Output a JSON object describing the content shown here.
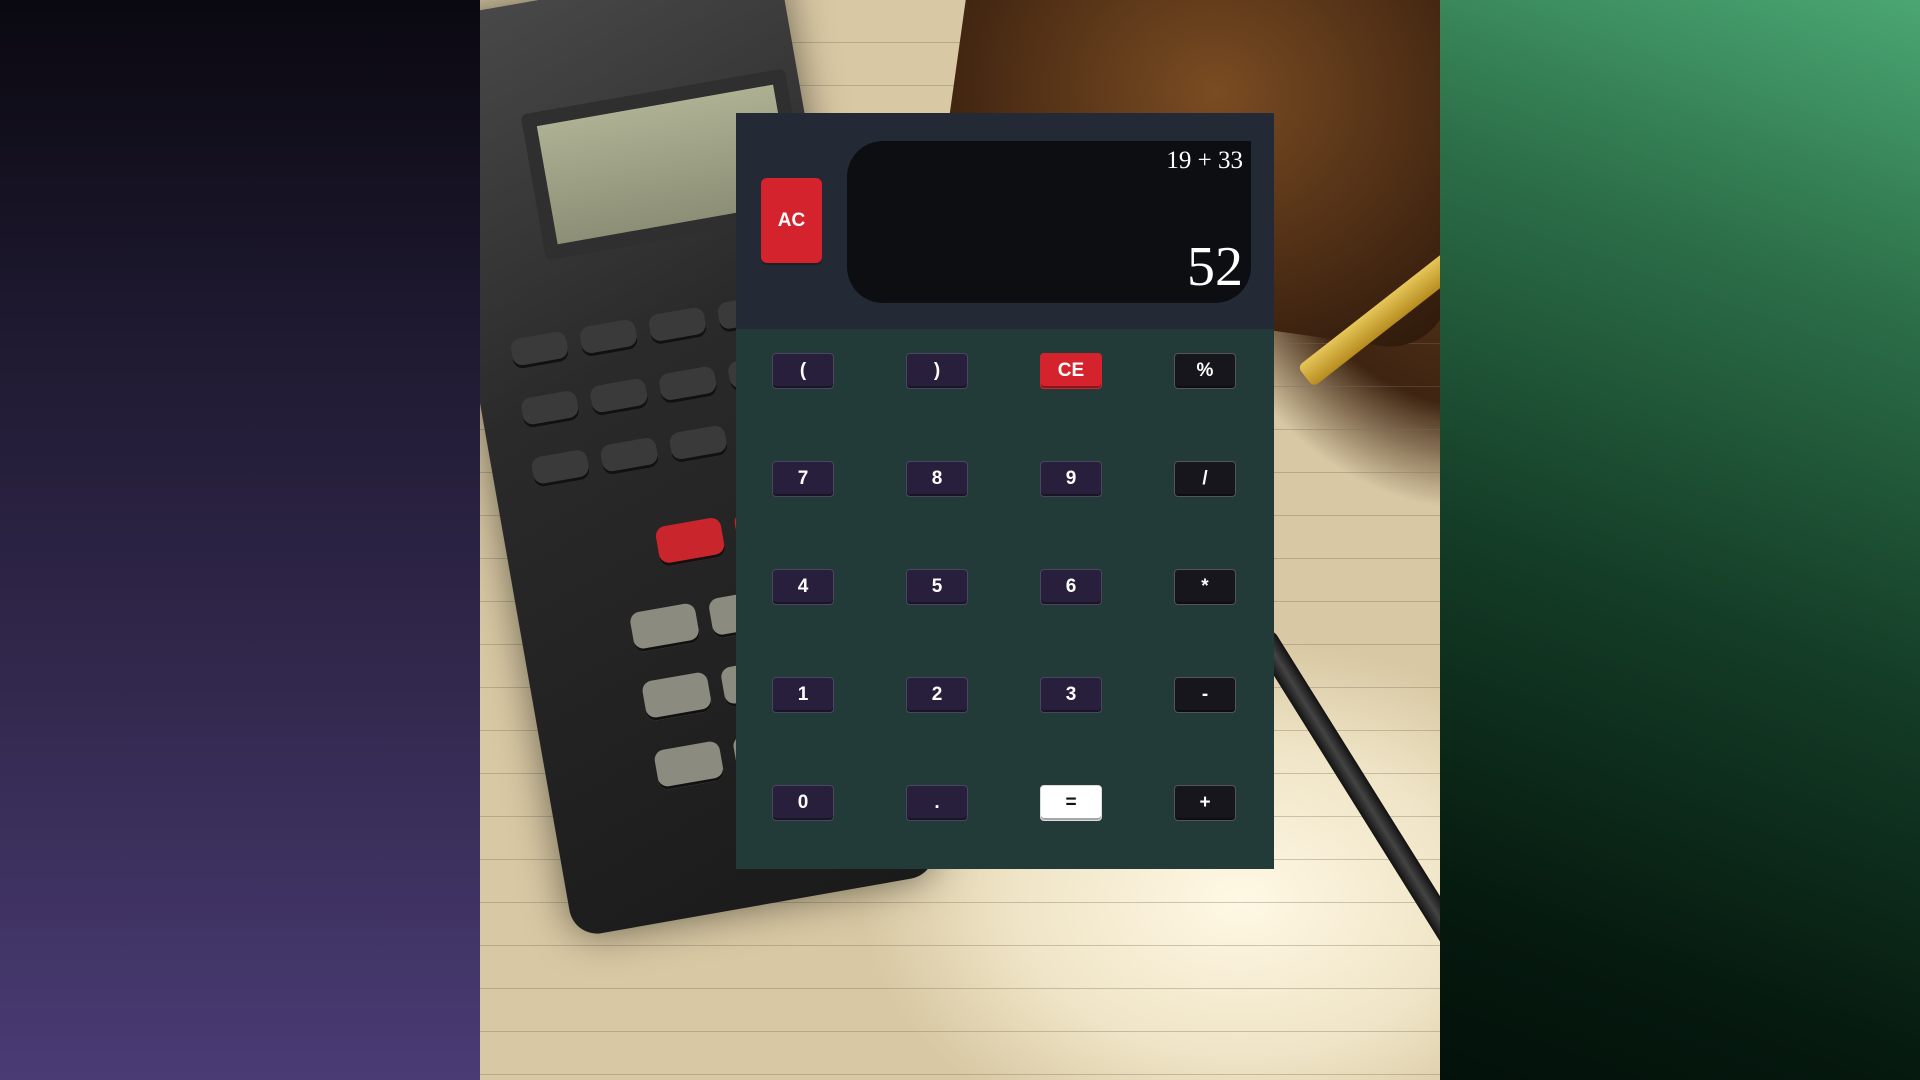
{
  "calculator": {
    "clear_all_label": "AC",
    "display": {
      "expression": "19 + 33",
      "result": "52"
    },
    "keys": [
      {
        "label": "(",
        "style": "purple"
      },
      {
        "label": ")",
        "style": "purple"
      },
      {
        "label": "CE",
        "style": "red"
      },
      {
        "label": "%",
        "style": "dark"
      },
      {
        "label": "7",
        "style": "purple"
      },
      {
        "label": "8",
        "style": "purple"
      },
      {
        "label": "9",
        "style": "purple"
      },
      {
        "label": "/",
        "style": "dark"
      },
      {
        "label": "4",
        "style": "purple"
      },
      {
        "label": "5",
        "style": "purple"
      },
      {
        "label": "6",
        "style": "purple"
      },
      {
        "label": "*",
        "style": "dark"
      },
      {
        "label": "1",
        "style": "purple"
      },
      {
        "label": "2",
        "style": "purple"
      },
      {
        "label": "3",
        "style": "purple"
      },
      {
        "label": "-",
        "style": "dark"
      },
      {
        "label": "0",
        "style": "purple"
      },
      {
        "label": ".",
        "style": "purple"
      },
      {
        "label": "=",
        "style": "white"
      },
      {
        "label": "+",
        "style": "dark"
      }
    ]
  },
  "colors": {
    "accent_red": "#d5232d",
    "key_purple": "#271f3b",
    "key_dark": "#16161c",
    "body": "#223a38",
    "header": "#242a35",
    "display_bg": "#0c0e12"
  }
}
